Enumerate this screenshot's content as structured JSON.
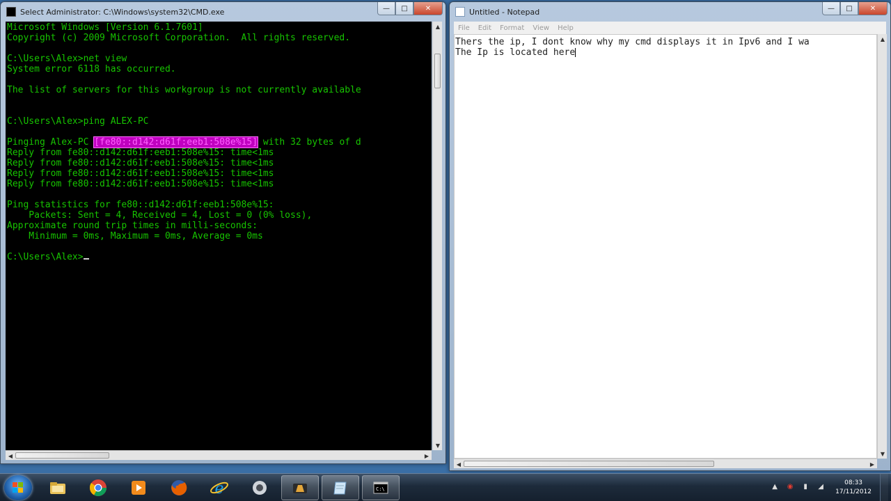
{
  "cmd": {
    "title": "Select Administrator: C:\\Windows\\system32\\CMD.exe",
    "lines": [
      "Microsoft Windows [Version 6.1.7601]",
      "Copyright (c) 2009 Microsoft Corporation.  All rights reserved.",
      "",
      "C:\\Users\\Alex>net view",
      "System error 6118 has occurred.",
      "",
      "The list of servers for this workgroup is not currently available",
      "",
      "",
      "C:\\Users\\Alex>ping ALEX-PC",
      ""
    ],
    "ping_prefix": "Pinging Alex-PC ",
    "ping_highlight": "[fe80::d142:d61f:eeb1:508e%15]",
    "ping_suffix": " with 32 bytes of d",
    "lines_after": [
      "Reply from fe80::d142:d61f:eeb1:508e%15: time<1ms",
      "Reply from fe80::d142:d61f:eeb1:508e%15: time<1ms",
      "Reply from fe80::d142:d61f:eeb1:508e%15: time<1ms",
      "Reply from fe80::d142:d61f:eeb1:508e%15: time<1ms",
      "",
      "Ping statistics for fe80::d142:d61f:eeb1:508e%15:",
      "    Packets: Sent = 4, Received = 4, Lost = 0 (0% loss),",
      "Approximate round trip times in milli-seconds:",
      "    Minimum = 0ms, Maximum = 0ms, Average = 0ms",
      ""
    ],
    "prompt": "C:\\Users\\Alex>"
  },
  "notepad": {
    "title": "Untitled - Notepad",
    "menu": [
      "File",
      "Edit",
      "Format",
      "View",
      "Help"
    ],
    "lines": [
      "Thers the ip, I dont know why my cmd displays it in Ipv6 and I wa",
      "The Ip is located here"
    ]
  },
  "caption": {
    "minimize": "—",
    "maximize": "□",
    "close": "✕"
  },
  "taskbar": {
    "icons": [
      "windows-explorer-icon",
      "chrome-icon",
      "media-player-icon",
      "firefox-icon",
      "internet-explorer-icon",
      "app-icon",
      "cmd-pinned-icon",
      "notepad-icon",
      "cmd-icon"
    ],
    "tray_icons": [
      "show-hidden-icons-arrow",
      "network-icon",
      "battery-icon",
      "volume-icon"
    ],
    "time": "08:33",
    "date": "17/11/2012"
  }
}
